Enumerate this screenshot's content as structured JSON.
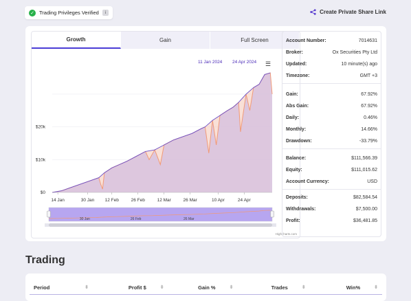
{
  "badge": {
    "label": "Trading Privileges Verified",
    "check_icon": "check-icon",
    "info_icon": "info-icon"
  },
  "share": {
    "label": "Create Private Share Link",
    "icon": "share-icon"
  },
  "tabs": [
    {
      "label": "Growth",
      "active": true
    },
    {
      "label": "Gain",
      "active": false
    },
    {
      "label": "Full Screen",
      "active": false
    }
  ],
  "range": {
    "from": "11 Jan 2024",
    "to": "24 Apr 2024"
  },
  "menu_icon": "hamburger-menu-icon",
  "chart_data": {
    "type": "area",
    "title": "",
    "xlabel": "",
    "ylabel": "",
    "x_ticks": [
      "14 Jan",
      "30 Jan",
      "12 Feb",
      "26 Feb",
      "12 Mar",
      "26 Mar",
      "10 Apr",
      "24 Apr"
    ],
    "y_ticks": [
      "$0",
      "$10k",
      "$20k"
    ],
    "ylim": [
      0,
      36500
    ],
    "x_day_range": [
      "2024-01-11",
      "2024-04-24"
    ],
    "series": [
      {
        "values": [
          [
            0,
            0
          ],
          [
            5,
            500
          ],
          [
            10,
            1500
          ],
          [
            15,
            2500
          ],
          [
            20,
            3500
          ],
          [
            25,
            4500
          ],
          [
            28,
            6000
          ],
          [
            32,
            7500
          ],
          [
            36,
            8500
          ],
          [
            40,
            9500
          ],
          [
            45,
            11000
          ],
          [
            50,
            12500
          ],
          [
            55,
            13000
          ],
          [
            60,
            14500
          ],
          [
            65,
            16000
          ],
          [
            70,
            17000
          ],
          [
            75,
            18000
          ],
          [
            80,
            19500
          ],
          [
            82,
            20000
          ],
          [
            86,
            22000
          ],
          [
            90,
            23500
          ],
          [
            94,
            25000
          ],
          [
            97,
            26000
          ],
          [
            100,
            27500
          ],
          [
            104,
            30000
          ],
          [
            108,
            32000
          ],
          [
            111,
            33000
          ],
          [
            114,
            36000
          ],
          [
            117,
            36500
          ]
        ],
        "color": "#7b4bd6"
      }
    ],
    "dips": [
      {
        "x": 26,
        "y": 2500
      },
      {
        "x": 27,
        "y": 1000
      },
      {
        "x": 52,
        "y": 10000
      },
      {
        "x": 58,
        "y": 8500
      },
      {
        "x": 84,
        "y": 12000
      },
      {
        "x": 88,
        "y": 14500
      },
      {
        "x": 101,
        "y": 18500
      },
      {
        "x": 106,
        "y": 25000
      },
      {
        "x": 118,
        "y": 30000
      }
    ],
    "navigator_ticks": [
      "30 Jan",
      "26 Feb",
      "26 Mar"
    ],
    "credits": "Highcharts.com"
  },
  "stats": {
    "group1": [
      {
        "k": "Account Number:",
        "v": "7014631"
      },
      {
        "k": "Broker:",
        "v": "Ox Securities Pty Ltd"
      },
      {
        "k": "Updated:",
        "v": "10 minute(s) ago"
      },
      {
        "k": "Timezone:",
        "v": "GMT +3"
      }
    ],
    "group2": [
      {
        "k": "Gain:",
        "v": "67.92%"
      },
      {
        "k": "Abs Gain:",
        "v": "67.92%"
      },
      {
        "k": "Daily:",
        "v": "0.46%"
      },
      {
        "k": "Monthly:",
        "v": "14.66%"
      },
      {
        "k": "Drawdown:",
        "v": "-33.79%"
      }
    ],
    "group3": [
      {
        "k": "Balance:",
        "v": "$111,566.39"
      },
      {
        "k": "Equity:",
        "v": "$111,015.62"
      },
      {
        "k": "Account Currency:",
        "v": "USD"
      }
    ],
    "group4": [
      {
        "k": "Deposits:",
        "v": "$82,584.54"
      },
      {
        "k": "Withdrawals:",
        "v": "$7,500.00"
      },
      {
        "k": "Profit:",
        "v": "$36,481.85"
      }
    ]
  },
  "trading": {
    "title": "Trading",
    "columns": [
      "Period",
      "Profit $",
      "Gain %",
      "Trades",
      "Win%"
    ]
  }
}
